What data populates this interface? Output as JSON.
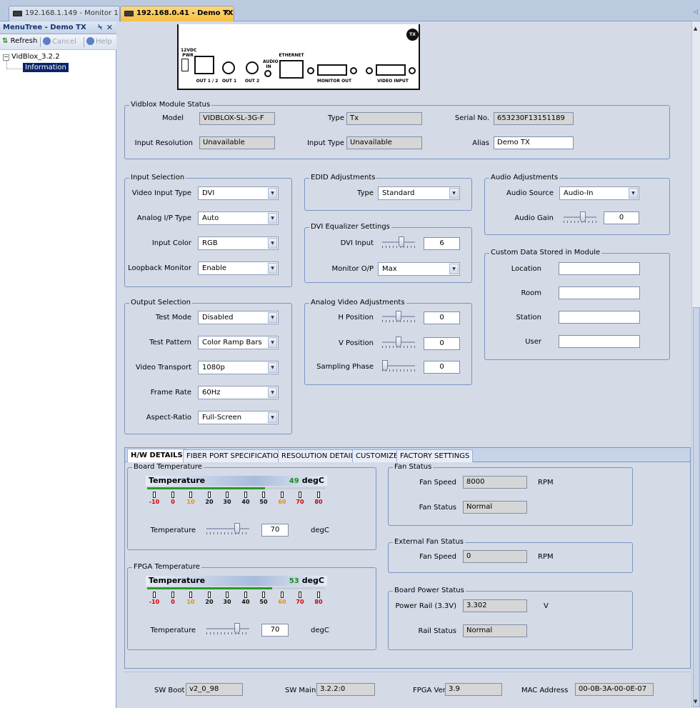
{
  "doc_tabs": [
    {
      "label": "192.168.1.149 - Monitor 1",
      "active": false
    },
    {
      "label": "192.168.0.41 - Demo TX",
      "active": true
    }
  ],
  "left_panel": {
    "title": "MenuTree - Demo TX",
    "pin_glyph": "⍀",
    "close_glyph": "✕",
    "toolbar": {
      "refresh": "Refresh",
      "cancel": "Cancel",
      "help": "Help"
    },
    "tree": {
      "root": "VidBlox_3.2.2",
      "child": "Information"
    }
  },
  "device": {
    "pwr_label": "12VDC\nPWR",
    "audio_label": "AUDIO\nIN",
    "ethernet_label": "ETHERNET",
    "out12": "OUT 1 / 2",
    "out1": "OUT 1",
    "out2": "OUT 2",
    "monitor_out": "MONITOR OUT",
    "video_input": "VIDEO INPUT",
    "badge": "TX"
  },
  "module_status": {
    "legend": "Vidblox Module Status",
    "model_label": "Model",
    "model": "VIDBLOX-SL-3G-F",
    "type_label": "Type",
    "type": "Tx",
    "serial_label": "Serial No.",
    "serial": "653230F13151189",
    "input_res_label": "Input Resolution",
    "input_res": "Unavailable",
    "input_type_label": "Input Type",
    "input_type": "Unavailable",
    "alias_label": "Alias",
    "alias": "Demo TX"
  },
  "input_selection": {
    "legend": "Input Selection",
    "rows": [
      {
        "label": "Video Input Type",
        "value": "DVI"
      },
      {
        "label": "Analog I/P Type",
        "value": "Auto"
      },
      {
        "label": "Input Color",
        "value": "RGB"
      },
      {
        "label": "Loopback Monitor",
        "value": "Enable"
      }
    ]
  },
  "output_selection": {
    "legend": "Output Selection",
    "rows": [
      {
        "label": "Test Mode",
        "value": "Disabled"
      },
      {
        "label": "Test Pattern",
        "value": "Color Ramp Bars"
      },
      {
        "label": "Video Transport",
        "value": "1080p"
      },
      {
        "label": "Frame Rate",
        "value": "60Hz"
      },
      {
        "label": "Aspect-Ratio",
        "value": "Full-Screen"
      }
    ]
  },
  "edid": {
    "legend": "EDID Adjustments",
    "type_label": "Type",
    "type": "Standard"
  },
  "dvi_eq": {
    "legend": "DVI Equalizer Settings",
    "dvi_input_label": "DVI Input",
    "dvi_input": "6",
    "dvi_input_level": 0.6,
    "monitor_op_label": "Monitor O/P",
    "monitor_op": "Max"
  },
  "analog_adj": {
    "legend": "Analog Video Adjustments",
    "rows": [
      {
        "label": "H Position",
        "value": "0",
        "level": 0.5
      },
      {
        "label": "V Position",
        "value": "0",
        "level": 0.5
      },
      {
        "label": "Sampling Phase",
        "value": "0",
        "level": 0.0
      }
    ]
  },
  "audio_adj": {
    "legend": "Audio Adjustments",
    "source_label": "Audio Source",
    "source": "Audio-In",
    "gain_label": "Audio Gain",
    "gain": "0",
    "gain_level": 0.6
  },
  "custom_data": {
    "legend": "Custom Data Stored in Module",
    "rows": [
      {
        "label": "Location",
        "value": ""
      },
      {
        "label": "Room",
        "value": ""
      },
      {
        "label": "Station",
        "value": ""
      },
      {
        "label": "User",
        "value": ""
      }
    ]
  },
  "lower_tabs": [
    "H/W DETAILS",
    "FIBER PORT SPECIFICATIONS",
    "RESOLUTION DETAILS",
    "CUSTOMIZE",
    "FACTORY SETTINGS"
  ],
  "board_temp": {
    "legend": "Board Temperature",
    "gauge_title": "Temperature",
    "reading": "49",
    "unit": "degC",
    "fill_fraction": 0.66,
    "ticks": [
      "-10",
      "0",
      "10",
      "20",
      "30",
      "40",
      "50",
      "60",
      "70",
      "80"
    ],
    "setting_label": "Temperature",
    "setting": "70",
    "setting_unit": "degC",
    "setting_level": 0.75
  },
  "fpga_temp": {
    "legend": "FPGA Temperature",
    "gauge_title": "Temperature",
    "reading": "53",
    "unit": "degC",
    "fill_fraction": 0.7,
    "ticks": [
      "-10",
      "0",
      "10",
      "20",
      "30",
      "40",
      "50",
      "60",
      "70",
      "80"
    ],
    "setting_label": "Temperature",
    "setting": "70",
    "setting_unit": "degC",
    "setting_level": 0.75
  },
  "fan_status": {
    "legend": "Fan Status",
    "speed_label": "Fan Speed",
    "speed": "8000",
    "speed_unit": "RPM",
    "status_label": "Fan Status",
    "status": "Normal"
  },
  "ext_fan": {
    "legend": "External Fan Status",
    "speed_label": "Fan Speed",
    "speed": "0",
    "speed_unit": "RPM"
  },
  "board_power": {
    "legend": "Board Power Status",
    "rail_label": "Power Rail (3.3V)",
    "rail": "3.302",
    "rail_unit": "V",
    "status_label": "Rail Status",
    "status": "Normal"
  },
  "footer": {
    "sw_boot_label": "SW Boot",
    "sw_boot": "v2_0_98",
    "sw_main_label": "SW Main",
    "sw_main": "3.2.2:0",
    "fpga_ver_label": "FPGA Ver",
    "fpga_ver": "3.9",
    "mac_label": "MAC Address",
    "mac": "00-0B-3A-00-0E-07"
  }
}
